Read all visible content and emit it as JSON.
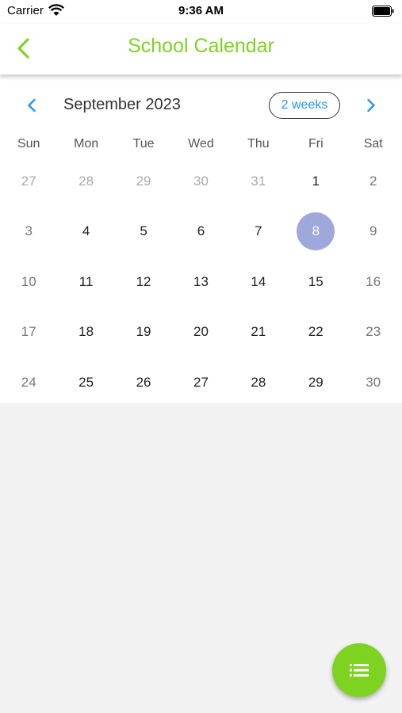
{
  "status_bar": {
    "carrier": "Carrier",
    "time": "9:36 AM"
  },
  "nav": {
    "title": "School Calendar",
    "back_icon": "chevron-left-icon",
    "accent_color": "#7ed321"
  },
  "calendar": {
    "month_title": "September 2023",
    "format_button": "2 weeks",
    "prev_icon": "chevron-left-icon",
    "next_icon": "chevron-right-icon",
    "weekdays": [
      "Sun",
      "Mon",
      "Tue",
      "Wed",
      "Thu",
      "Fri",
      "Sat"
    ],
    "selected_color": "#9fa8da",
    "weeks": [
      [
        {
          "label": "27",
          "outside": true
        },
        {
          "label": "28",
          "outside": true
        },
        {
          "label": "29",
          "outside": true
        },
        {
          "label": "30",
          "outside": true
        },
        {
          "label": "31",
          "outside": true
        },
        {
          "label": "1"
        },
        {
          "label": "2"
        }
      ],
      [
        {
          "label": "3"
        },
        {
          "label": "4"
        },
        {
          "label": "5"
        },
        {
          "label": "6"
        },
        {
          "label": "7"
        },
        {
          "label": "8",
          "selected": true
        },
        {
          "label": "9"
        }
      ],
      [
        {
          "label": "10"
        },
        {
          "label": "11"
        },
        {
          "label": "12"
        },
        {
          "label": "13"
        },
        {
          "label": "14"
        },
        {
          "label": "15"
        },
        {
          "label": "16"
        }
      ],
      [
        {
          "label": "17"
        },
        {
          "label": "18"
        },
        {
          "label": "19"
        },
        {
          "label": "20"
        },
        {
          "label": "21"
        },
        {
          "label": "22"
        },
        {
          "label": "23"
        }
      ],
      [
        {
          "label": "24"
        },
        {
          "label": "25"
        },
        {
          "label": "26"
        },
        {
          "label": "27"
        },
        {
          "label": "28"
        },
        {
          "label": "29"
        },
        {
          "label": "30"
        }
      ]
    ]
  },
  "fab": {
    "icon": "list-icon"
  }
}
